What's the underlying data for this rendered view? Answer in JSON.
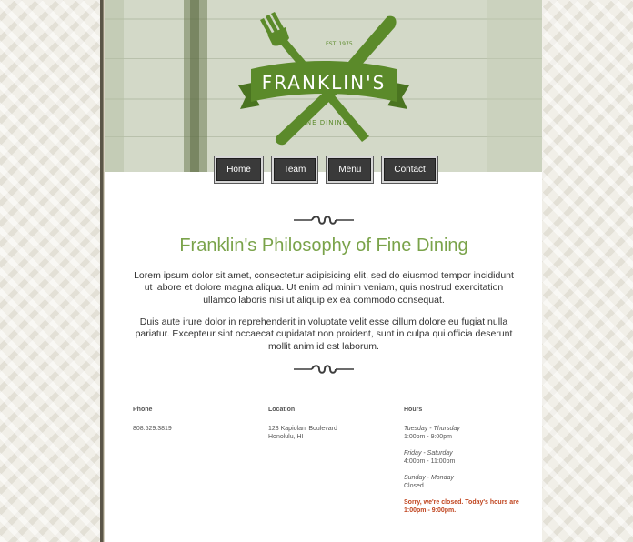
{
  "brand": {
    "name": "FRANKLIN'S",
    "established": "EST. 1975",
    "tagline": "FINE DINING",
    "colors": {
      "green": "#5b8a2a",
      "title_green": "#7aa34a",
      "notice_red": "#c0441e",
      "nav_bg": "#3a3a3a"
    }
  },
  "nav": {
    "items": [
      {
        "label": "Home"
      },
      {
        "label": "Team"
      },
      {
        "label": "Menu"
      },
      {
        "label": "Contact"
      }
    ]
  },
  "main": {
    "title": "Franklin's Philosophy of Fine Dining",
    "paragraphs": [
      "Lorem ipsum dolor sit amet, consectetur adipisicing elit, sed do eiusmod tempor incididunt ut labore et dolore magna aliqua. Ut enim ad minim veniam, quis nostrud exercitation ullamco laboris nisi ut aliquip ex ea commodo consequat.",
      "Duis aute irure dolor in reprehenderit in voluptate velit esse cillum dolore eu fugiat nulla pariatur. Excepteur sint occaecat cupidatat non proident, sunt in culpa qui officia deserunt mollit anim id est laborum."
    ]
  },
  "footer": {
    "phone": {
      "heading": "Phone",
      "value": "808.529.3819"
    },
    "location": {
      "heading": "Location",
      "line1": "123 Kapiolani Boulevard",
      "line2": "Honolulu, HI"
    },
    "hours": {
      "heading": "Hours",
      "groups": [
        {
          "days": "Tuesday - Thursday",
          "time": "1:00pm - 9:00pm"
        },
        {
          "days": "Friday - Saturday",
          "time": "4:00pm - 11:00pm"
        },
        {
          "days": "Sunday - Monday",
          "time": "Closed"
        }
      ],
      "notice": "Sorry, we're closed. Today's hours are 1:00pm - 9:00pm."
    }
  },
  "icons": {
    "logo": "fork-knife-logo",
    "divider": "flourish-divider"
  }
}
